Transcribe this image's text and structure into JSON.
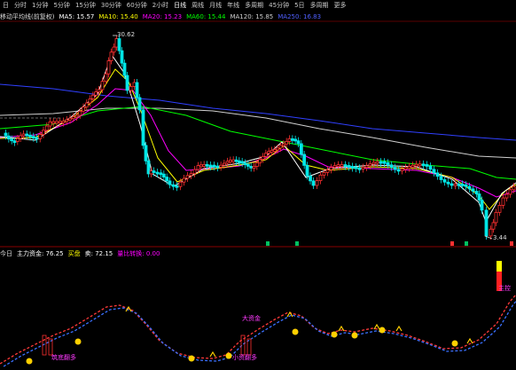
{
  "toolbar": {
    "items": [
      {
        "label": "日",
        "icon": "",
        "active": false
      },
      {
        "label": "分时",
        "active": false
      },
      {
        "label": "1分钟",
        "active": false
      },
      {
        "label": "5分钟",
        "active": false
      },
      {
        "label": "15分钟",
        "active": false
      },
      {
        "label": "30分钟",
        "active": false
      },
      {
        "label": "60分钟",
        "active": false
      },
      {
        "label": "2小时",
        "active": false
      },
      {
        "label": "日线",
        "active": true
      },
      {
        "label": "周线",
        "active": false
      },
      {
        "label": "月线",
        "active": false
      },
      {
        "label": "年线",
        "active": false
      },
      {
        "label": "多周期",
        "active": false
      },
      {
        "label": "45分钟",
        "active": false
      },
      {
        "label": "5日",
        "active": false
      },
      {
        "label": "多周期",
        "active": false
      },
      {
        "label": "更多",
        "active": false
      }
    ]
  },
  "main_info": {
    "title": "移动平均线(前复权)",
    "ma5": "MA5: 15.57",
    "ma10": "MA10: 15.40",
    "ma20": "MA20: 15.23",
    "ma60": "MA60: 15.44",
    "ma120": "MA120: 15.85",
    "ma250": "MA250: 16.83",
    "colors": {
      "ma5": "#ffffff",
      "ma10": "#ffff00",
      "ma20": "#ff00ff",
      "ma60": "#00ff00",
      "ma120": "#d0d0d0",
      "ma250": "#3040ff"
    }
  },
  "sub_info": {
    "title": "今日",
    "item1": "主力资金: 76.25",
    "item2": "买盘",
    "item3": "卖: 72.15",
    "item4": "量比转换: 0.00"
  },
  "price_labels": {
    "high": "30.62",
    "low": "3.44"
  },
  "annotations": {
    "a1": "筑底翻多",
    "a2": "大资金",
    "a3": "小资翻多",
    "a4": "主控"
  },
  "chart_data": {
    "type": "candlestick",
    "title": "",
    "ma_legend": [
      "MA5",
      "MA10",
      "MA20",
      "MA60",
      "MA120",
      "MA250"
    ],
    "high_label": 30.62,
    "low_label": 3.44
  }
}
